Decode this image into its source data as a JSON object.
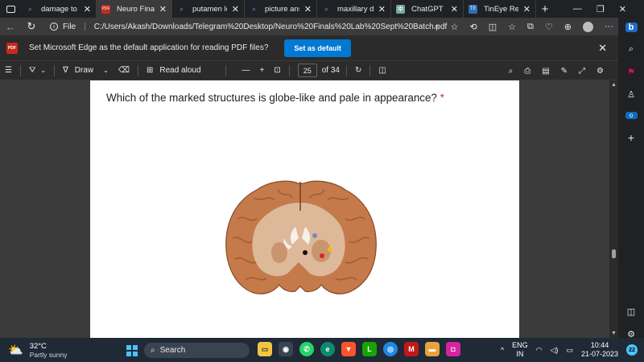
{
  "browser": {
    "tabs": [
      {
        "label": "damage to wer",
        "icon": "search-icon",
        "active": false
      },
      {
        "label": "Neuro Finals La",
        "icon": "pdf-icon",
        "active": true
      },
      {
        "label": "putamen locati",
        "icon": "search-icon",
        "active": false
      },
      {
        "label": "picture answer",
        "icon": "search-icon",
        "active": false
      },
      {
        "label": "maxillary divisi",
        "icon": "search-icon",
        "active": false
      },
      {
        "label": "ChatGPT",
        "icon": "chatgpt-icon",
        "active": false
      },
      {
        "label": "TinEye Reverse",
        "icon": "tineye-icon",
        "active": false
      }
    ],
    "new_tab": "+",
    "window_controls": [
      "—",
      "❐",
      "✕"
    ],
    "address": {
      "scheme_label": "File",
      "url": "C:/Users/Akash/Downloads/Telegram%20Desktop/Neuro%20Finals%20Lab%20Sept%20Batch.pdf"
    }
  },
  "infobar": {
    "message": "Set Microsoft Edge as the default application for reading PDF files?",
    "button": "Set as default"
  },
  "pdf_toolbar": {
    "draw": "Draw",
    "read_aloud": "Read aloud",
    "page_current": "25",
    "page_total": "of 34"
  },
  "document": {
    "question": "Which of the marked structures is globe-like and pale in appearance?",
    "required_mark": "*",
    "markers": [
      {
        "color": "#7b86c4",
        "name": "blue-marker"
      },
      {
        "color": "#f0c010",
        "name": "yellow-marker"
      },
      {
        "color": "#e02020",
        "name": "red-marker"
      },
      {
        "color": "#111111",
        "name": "black-marker"
      }
    ]
  },
  "taskbar": {
    "weather_temp": "32°C",
    "weather_desc": "Partly sunny",
    "search": "Search",
    "lang_top": "ENG",
    "lang_bottom": "IN",
    "time": "10:44",
    "date": "21-07-2023",
    "notifications": "22"
  }
}
